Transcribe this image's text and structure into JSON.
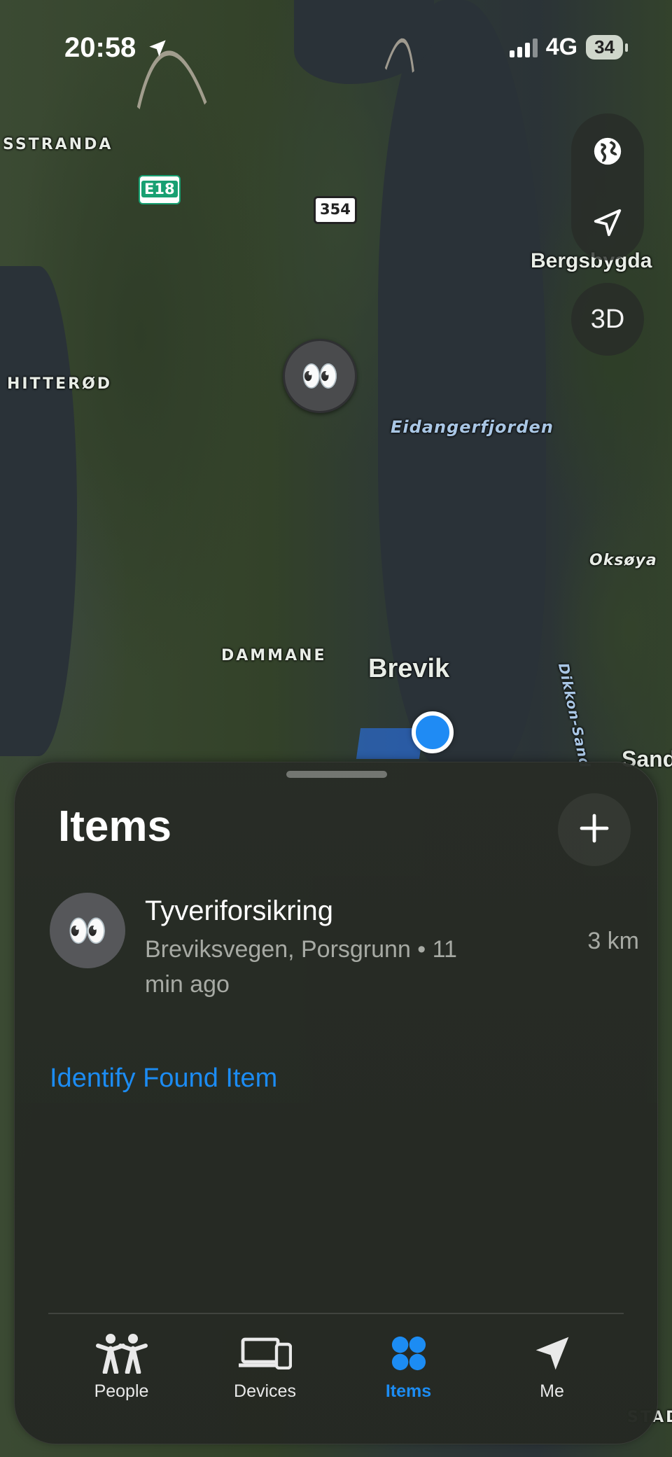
{
  "status_bar": {
    "time": "20:58",
    "network": "4G",
    "battery": "34"
  },
  "map": {
    "labels": {
      "sstranda": "SSTRANDA",
      "hitterod": "HITTERØD",
      "dammane": "DAMMANE",
      "brevik": "Brevik",
      "bergsbygda": "Bergsbygda",
      "eidangerfjorden": "Eidangerfjorden",
      "oksoya": "Oksøya",
      "dikkon_sand": "Dikkon-Sand",
      "sand": "Sand",
      "stad": "STAD"
    },
    "road_shields": {
      "e18": "E18",
      "r354": "354"
    },
    "item_pin_emoji": "👀",
    "controls": {
      "three_d": "3D"
    }
  },
  "sheet": {
    "title": "Items",
    "items": [
      {
        "emoji": "👀",
        "name": "Tyveriforsikring",
        "subtitle": "Breviksvegen, Porsgrunn • 11 min ago",
        "distance": "3 km"
      }
    ],
    "identify_link": "Identify Found Item"
  },
  "tab_bar": {
    "tabs": [
      {
        "label": "People",
        "icon": "people-icon",
        "active": false
      },
      {
        "label": "Devices",
        "icon": "devices-icon",
        "active": false
      },
      {
        "label": "Items",
        "icon": "items-icon",
        "active": true
      },
      {
        "label": "Me",
        "icon": "location-arrow-icon",
        "active": false
      }
    ]
  },
  "colors": {
    "accent": "#1c8cf3",
    "sheet_bg": "#282c26",
    "secondary_text": "#a7aaa4"
  }
}
